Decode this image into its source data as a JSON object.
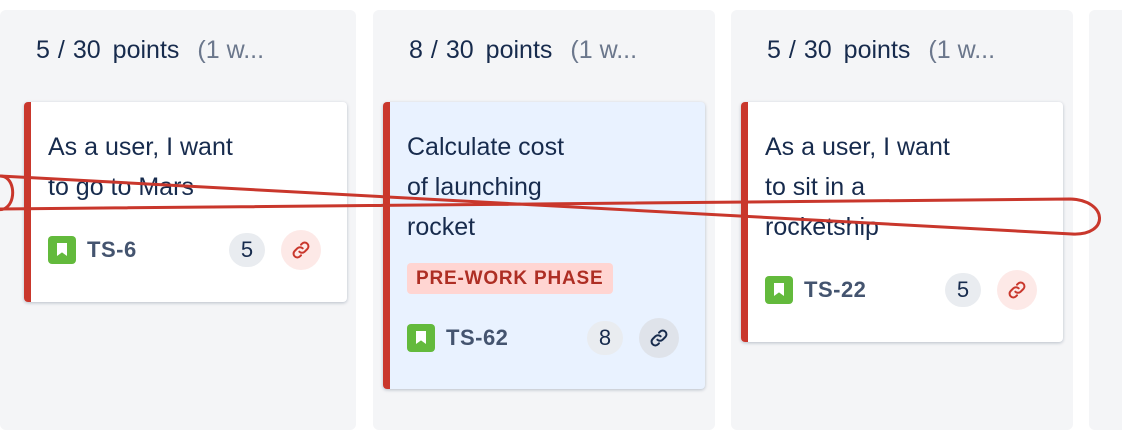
{
  "columns": [
    {
      "header": {
        "done": "5",
        "sep": "/",
        "total": "30",
        "unit": "points",
        "duration": "(1 w..."
      },
      "card": {
        "title_line1": "As a user, I want",
        "title_line2": "to go to Mars",
        "title_line3": "",
        "key": "TS-6",
        "estimate": "5",
        "lozenge": ""
      }
    },
    {
      "header": {
        "done": "8",
        "sep": "/",
        "total": "30",
        "unit": "points",
        "duration": "(1 w..."
      },
      "card": {
        "title_line1": "Calculate cost",
        "title_line2": "of launching",
        "title_line3": "rocket",
        "key": "TS-62",
        "estimate": "8",
        "lozenge": "PRE-WORK PHASE"
      }
    },
    {
      "header": {
        "done": "5",
        "sep": "/",
        "total": "30",
        "unit": "points",
        "duration": "(1 w..."
      },
      "card": {
        "title_line1": "As a user, I want",
        "title_line2": "to sit in a",
        "title_line3": "rocketship",
        "key": "TS-22",
        "estimate": "5",
        "lozenge": ""
      }
    }
  ],
  "icons": {
    "story": "story-bookmark-icon",
    "link": "link-icon"
  },
  "colors": {
    "priority_stripe": "#c9372c",
    "story_icon": "#63ba3c",
    "lozenge_bg": "#ffd5d2",
    "lozenge_text": "#ae2e24",
    "dependency_line": "#c9372c",
    "active_card_bg": "#e9f2ff"
  }
}
